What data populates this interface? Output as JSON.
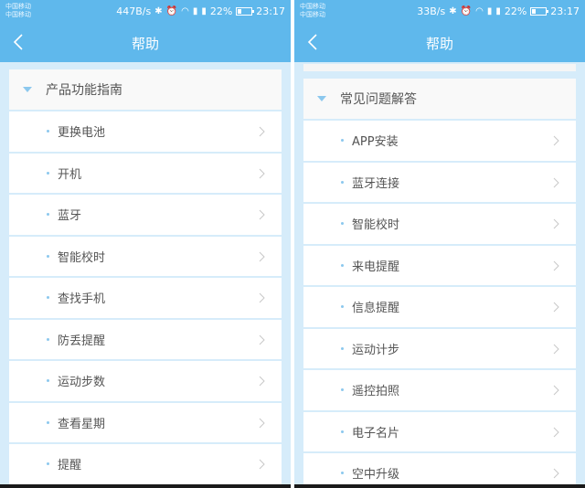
{
  "left": {
    "status": {
      "carrier1": "中国移动",
      "carrier2": "中国移动",
      "speed": "447B/s",
      "battery": "22%",
      "time": "23:17"
    },
    "appbar": {
      "title": "帮助"
    },
    "section": "产品功能指南",
    "items": [
      "更换电池",
      "开机",
      "蓝牙",
      "智能校时",
      "查找手机",
      "防丢提醒",
      "运动步数",
      "查看星期",
      "提醒"
    ]
  },
  "right": {
    "status": {
      "carrier1": "中国移动",
      "carrier2": "中国移动",
      "speed": "33B/s",
      "battery": "22%",
      "time": "23:17"
    },
    "appbar": {
      "title": "帮助"
    },
    "section": "常见问题解答",
    "items": [
      "APP安装",
      "蓝牙连接",
      "智能校时",
      "来电提醒",
      "信息提醒",
      "运动计步",
      "遥控拍照",
      "电子名片",
      "空中升级"
    ]
  },
  "colors": {
    "appbar": "#5fb8ec",
    "background": "#d6ecfa",
    "accent": "#8cc8ee"
  }
}
